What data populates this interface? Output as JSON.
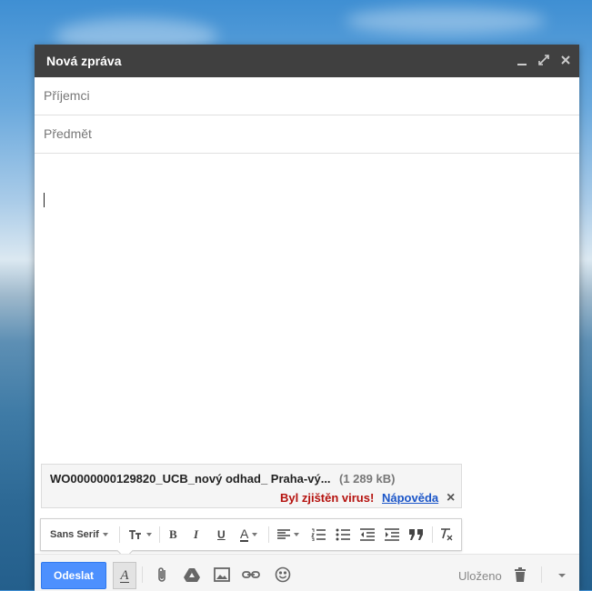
{
  "window": {
    "title": "Nová zpráva"
  },
  "fields": {
    "to_placeholder": "Příjemci",
    "subject_placeholder": "Předmět"
  },
  "attachment": {
    "name": "WO0000000129820_UCB_nový odhad_ Praha-vý...",
    "size": "(1 289 kB)",
    "warning": "Byl zjištěn virus!",
    "help_link": "Nápověda",
    "close_glyph": "×"
  },
  "formatting": {
    "font": "Sans Serif",
    "tools": [
      "font-size-icon",
      "bold-icon",
      "italic-icon",
      "underline-icon",
      "text-color-icon",
      "align-icon",
      "numbered-list-icon",
      "bulleted-list-icon",
      "indent-less-icon",
      "indent-more-icon",
      "quote-icon",
      "remove-formatting-icon"
    ],
    "bold_glyph": "B",
    "italic_glyph": "I",
    "underline_glyph": "U",
    "color_glyph": "A"
  },
  "bottom": {
    "send_label": "Odeslat",
    "format_toggle_glyph": "A",
    "saved_label": "Uloženo"
  },
  "colors": {
    "send": "#4d90fe",
    "titlebar": "#404040",
    "virus": "#b5120e",
    "link": "#1a55c8"
  }
}
